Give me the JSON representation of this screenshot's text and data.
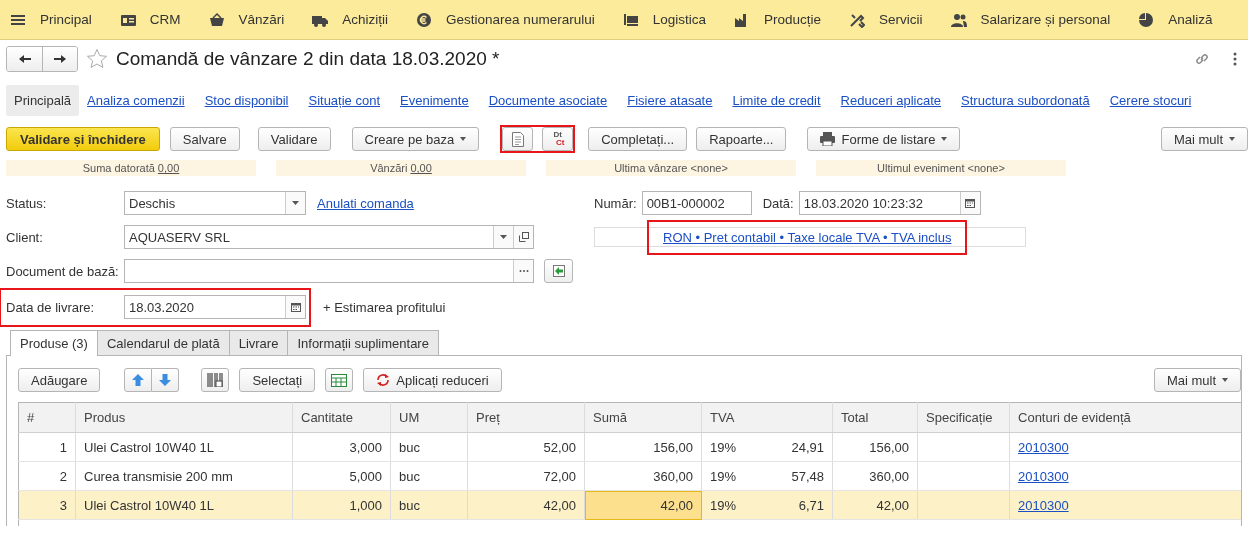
{
  "menu": [
    {
      "label": "Principal"
    },
    {
      "label": "CRM"
    },
    {
      "label": "Vânzări"
    },
    {
      "label": "Achiziții"
    },
    {
      "label": "Gestionarea numerarului"
    },
    {
      "label": "Logistica"
    },
    {
      "label": "Producție"
    },
    {
      "label": "Servicii"
    },
    {
      "label": "Salarizare și personal"
    },
    {
      "label": "Analiză"
    }
  ],
  "document": {
    "title": "Comandă de vânzare 2 din data 18.03.2020 *",
    "favorite": false
  },
  "sections": [
    {
      "label": "Principală",
      "selected": true
    },
    {
      "label": "Analiza comenzii",
      "selected": false
    },
    {
      "label": "Stoc disponibil",
      "selected": false
    },
    {
      "label": "Situație cont",
      "selected": false
    },
    {
      "label": "Evenimente",
      "selected": false
    },
    {
      "label": "Documente asociate",
      "selected": false
    },
    {
      "label": "Fisiere atasate",
      "selected": false
    },
    {
      "label": "Limite de credit",
      "selected": false
    },
    {
      "label": "Reduceri aplicate",
      "selected": false
    },
    {
      "label": "Structura subordonată",
      "selected": false
    },
    {
      "label": "Cerere stocuri",
      "selected": false
    }
  ],
  "toolbar": [
    {
      "kind": "primary",
      "label": "Validare și închidere",
      "highlighted": false
    },
    {
      "kind": "button",
      "label": "Salvare",
      "highlighted": false
    },
    {
      "kind": "button",
      "label": "Validare",
      "highlighted": false
    },
    {
      "kind": "menu",
      "label": "Creare pe baza",
      "highlighted": false
    },
    {
      "kind": "doc-icon",
      "highlighted": true
    },
    {
      "kind": "dtct",
      "top": "Dt",
      "bottom": "Ct",
      "highlighted": true
    },
    {
      "kind": "button",
      "label": "Completați...",
      "highlighted": false
    },
    {
      "kind": "button",
      "label": "Rapoarte...",
      "highlighted": false
    },
    {
      "kind": "print-menu",
      "label": "Forme de listare",
      "highlighted": false
    }
  ],
  "more_button": "Mai mult",
  "summary": [
    {
      "label": "Suma datorată",
      "value": "0,00"
    },
    {
      "label": "Vânzări",
      "value": "0,00"
    },
    {
      "label": "Ultima vânzare <none>"
    },
    {
      "label": "Ultimul eveniment <none>"
    }
  ],
  "form": {
    "status": {
      "label": "Status:",
      "value": "Deschis"
    },
    "cancel_link": "Anulati comanda",
    "number": {
      "label": "Număr:",
      "value": "00B1-000002"
    },
    "date": {
      "label": "Dată:",
      "value": "18.03.2020 10:23:32"
    },
    "client": {
      "label": "Client:",
      "value": "AQUASERV SRL"
    },
    "currency_link": {
      "text": "RON • Pret contabil • Taxe locale TVA • TVA inclus",
      "highlighted": true
    },
    "base_document": {
      "label": "Document de bază:"
    },
    "delivery_date": {
      "label": "Data de livrare:",
      "value": "18.03.2020",
      "highlighted": true
    },
    "profit_link": "+ Estimarea profitului"
  },
  "tabs": [
    {
      "label": "Produse (3)",
      "selected": true
    },
    {
      "label": "Calendarul de plată",
      "selected": false
    },
    {
      "label": "Livrare",
      "selected": false
    },
    {
      "label": "Informații suplimentare",
      "selected": false
    }
  ],
  "table_toolbar": [
    {
      "kind": "button",
      "label": "Adăugare"
    },
    {
      "kind": "move-up"
    },
    {
      "kind": "move-down"
    },
    {
      "kind": "barcode"
    },
    {
      "kind": "button",
      "label": "Selectați"
    },
    {
      "kind": "sheet"
    },
    {
      "kind": "refresh-button",
      "label": "Aplicați reduceri"
    }
  ],
  "table_more": "Mai mult",
  "table": {
    "columns": [
      "#",
      "Produs",
      "Cantitate",
      "UM",
      "Preț",
      "Sumă",
      "TVA",
      "Total",
      "Specificație",
      "Conturi de evidență"
    ],
    "rows": [
      {
        "number": "1",
        "product": "Ulei Castrol 10W40 1L",
        "quantity": "3,000",
        "unit": "buc",
        "price": "52,00",
        "amount": "156,00",
        "vat_rate": "19%",
        "vat_amount": "24,91",
        "total": "156,00",
        "account": "2010300",
        "selected": false
      },
      {
        "number": "2",
        "product": "Curea transmisie 200 mm",
        "quantity": "5,000",
        "unit": "buc",
        "price": "72,00",
        "amount": "360,00",
        "vat_rate": "19%",
        "vat_amount": "57,48",
        "total": "360,00",
        "account": "2010300",
        "selected": false
      },
      {
        "number": "3",
        "product": "Ulei Castrol 10W40 1L",
        "quantity": "1,000",
        "unit": "buc",
        "price": "42,00",
        "amount": "42,00",
        "vat_rate": "19%",
        "vat_amount": "6,71",
        "total": "42,00",
        "account": "2010300",
        "selected": true
      }
    ]
  }
}
